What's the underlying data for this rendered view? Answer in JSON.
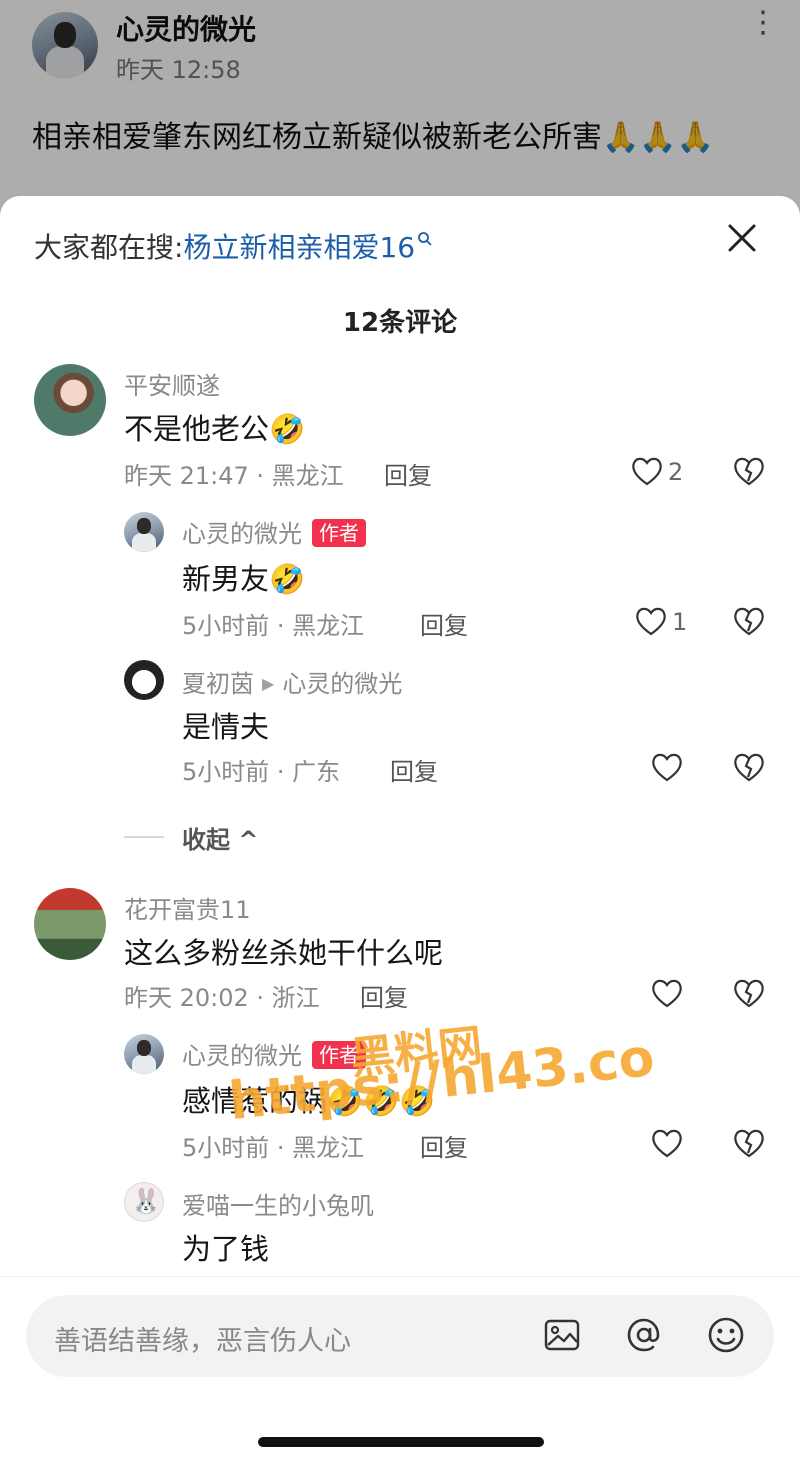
{
  "post": {
    "author": "心灵的微光",
    "time": "昨天 12:58",
    "text": "相亲相爱肇东网红杨立新疑似被新老公所害🙏🙏🙏"
  },
  "sheet": {
    "search_prefix": "大家都在搜:",
    "search_keyword": "杨立新相亲相爱16",
    "comment_count": "12条评论"
  },
  "comments": [
    {
      "user": "平安顺遂",
      "text": "不是他老公🤣",
      "meta": "昨天 21:47 · 黑龙江",
      "reply": "回复",
      "likes": "2"
    },
    {
      "user": "心灵的微光",
      "badge": "作者",
      "text": "新男友🤣",
      "meta": "5小时前 · 黑龙江",
      "reply": "回复",
      "likes": "1"
    },
    {
      "user": "夏初茵",
      "reply_to": "心灵的微光",
      "text": "是情夫",
      "meta": "5小时前 · 广东",
      "reply": "回复"
    },
    {
      "user": "花开富贵11",
      "text": "这么多粉丝杀她干什么呢",
      "meta": "昨天 20:02 · 浙江",
      "reply": "回复"
    },
    {
      "user": "心灵的微光",
      "badge": "作者",
      "text": "感情惹的祸🤣🤣🤣",
      "meta": "5小时前 · 黑龙江",
      "reply": "回复"
    },
    {
      "user": "爱喵一生的小兔叽",
      "text": "为了钱"
    }
  ],
  "collapse_label": "收起 ^",
  "input": {
    "placeholder": "善语结善缘，恶言伤人心"
  },
  "watermark": {
    "line1": "黑料网",
    "line2": "https://hl43.co"
  },
  "colors": {
    "accent_link": "#1c5fa8",
    "author_badge": "#f2314f",
    "watermark": "#f7a832"
  }
}
